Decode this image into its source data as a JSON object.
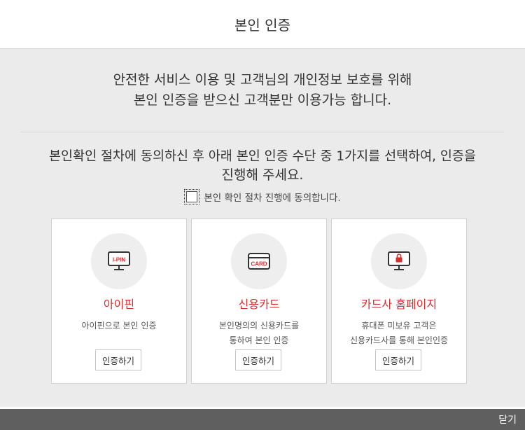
{
  "header": {
    "title": "본인 인증"
  },
  "intro": {
    "line1": "안전한 서비스 이용 및 고객님의 개인정보 보호를 위해",
    "line2": "본인 인증을 받으신 고객분만 이용가능 합니다."
  },
  "instruction": {
    "line1": "본인확인 절차에 동의하신 후 아래 본인 인증 수단 중 1가지를 선택하여, 인증을",
    "line2": "진행해 주세요."
  },
  "agreement": {
    "label": "본인 확인 절차 진행에 동의합니다.",
    "checked": false
  },
  "methods": [
    {
      "icon": "ipin-monitor-icon",
      "icon_text": "I-PIN",
      "title": "아이핀",
      "desc_line1": "아이핀으로 본인 인증",
      "desc_line2": "",
      "button": "인증하기"
    },
    {
      "icon": "credit-card-icon",
      "icon_text": "CARD",
      "title": "신용카드",
      "desc_line1": "본인명의의 신용카드를",
      "desc_line2": "통하여 본인 인증",
      "button": "인증하기"
    },
    {
      "icon": "lock-monitor-icon",
      "title": "카드사 홈페이지",
      "desc_line1": "휴대폰 미보유 고객은",
      "desc_line2": "신용카드사를 통해 본인인증",
      "button": "인증하기"
    }
  ],
  "footer": {
    "close": "닫기"
  },
  "colors": {
    "accent": "#d32f2f",
    "footer_bg": "#5f5f5f",
    "page_bg": "#ebebeb"
  }
}
